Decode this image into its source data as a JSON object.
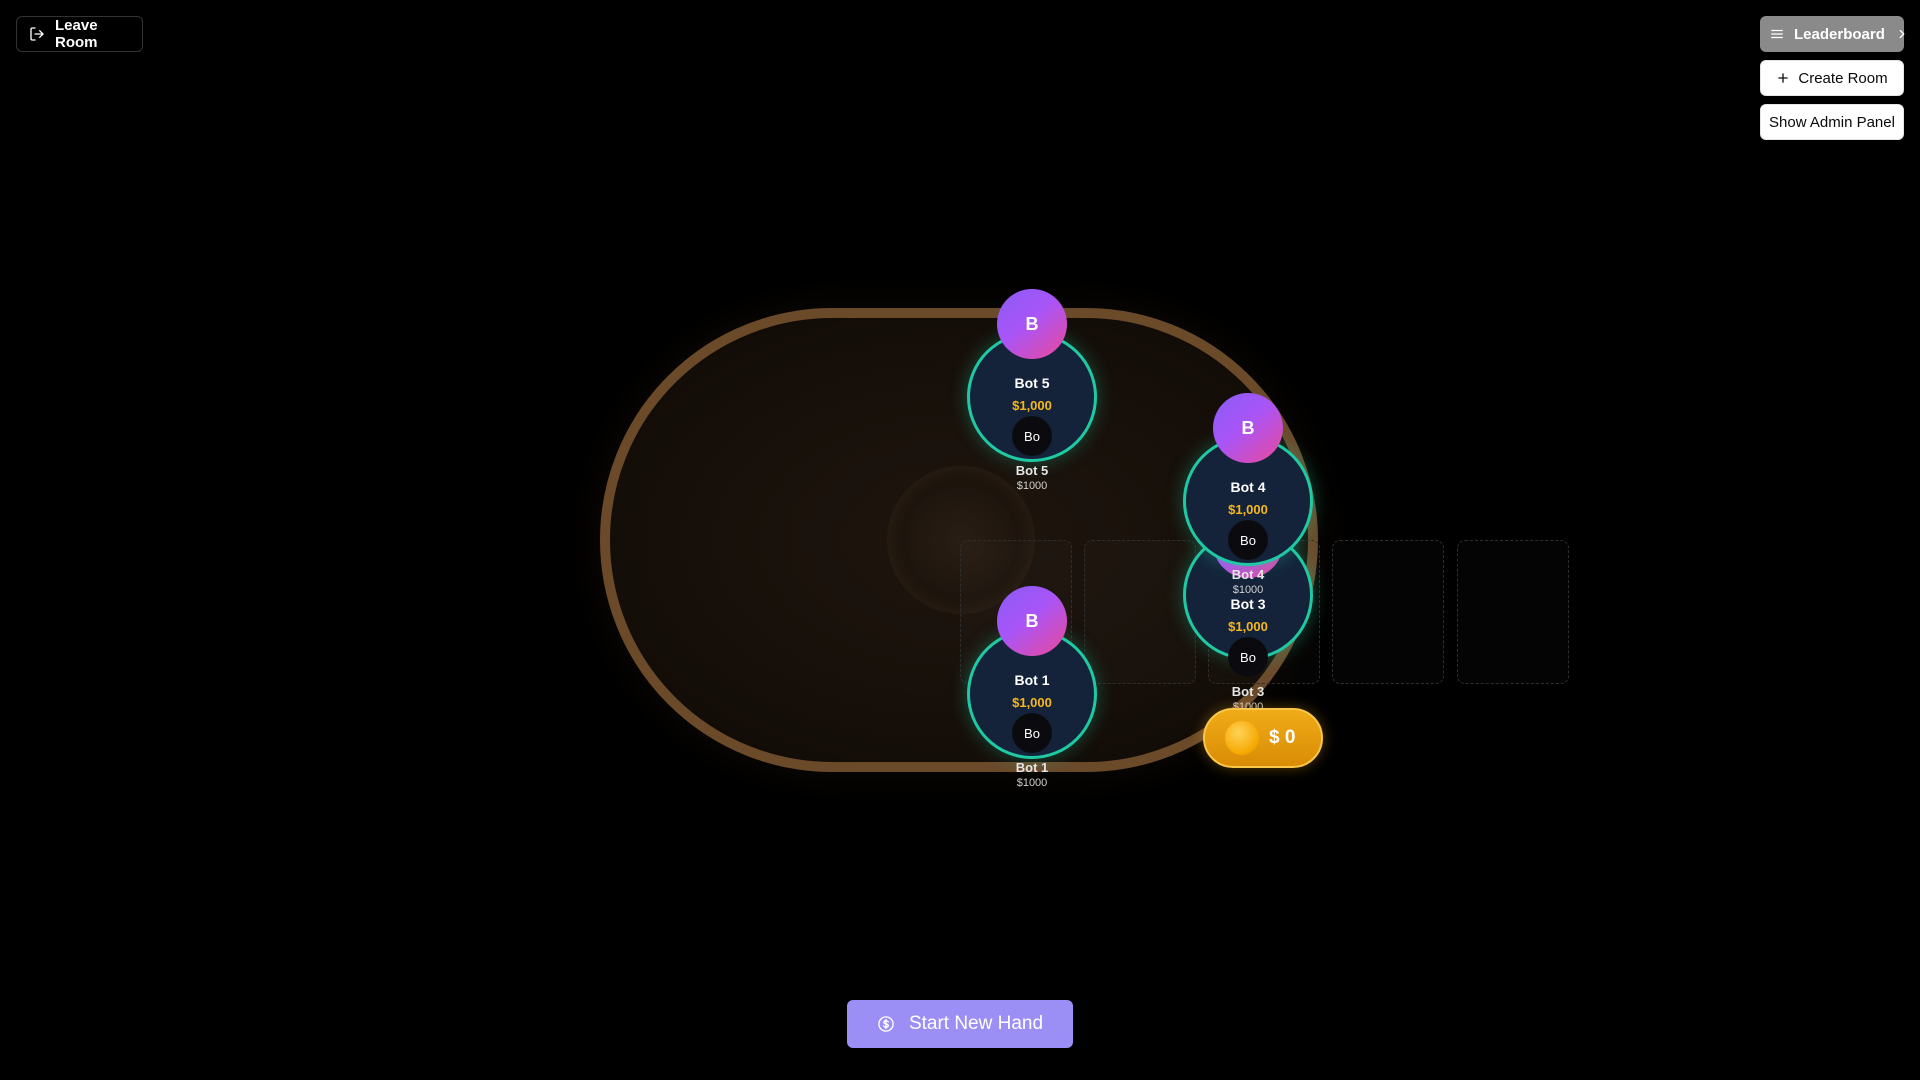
{
  "header": {
    "leave_room_label": "Leave Room",
    "leaderboard_label": "Leaderboard",
    "create_room_label": "Create Room",
    "admin_panel_label": "Show Admin Panel"
  },
  "seats": [
    {
      "avatar_letter": "B",
      "name": "Bot 5",
      "chips": "$1,000",
      "mini": "Bo",
      "label": "Bot 5",
      "amount": "$1000"
    },
    {
      "avatar_letter": "B",
      "name": "Bot 4",
      "chips": "$1,000",
      "mini": "Bo",
      "label": "Bot 4",
      "amount": "$1000"
    },
    {
      "avatar_letter": "B",
      "name": "Bot 3",
      "chips": "$1,000",
      "mini": "Bo",
      "label": "Bot 3",
      "amount": "$1000"
    },
    {
      "avatar_letter": "B",
      "name": "Bot 1",
      "chips": "$1,000",
      "mini": "Bo",
      "label": "Bot 1",
      "amount": "$1000"
    }
  ],
  "pot": {
    "currency": "$",
    "amount": "0",
    "display": "$ 0"
  },
  "actions": {
    "start_new_hand_label": "Start New Hand"
  },
  "colors": {
    "table_rail": "#6b4a2a",
    "seat_border": "#1fc9a3",
    "avatar_gradient": [
      "#8b5cf6",
      "#ec4899"
    ],
    "chips_text": "#f5b81c",
    "start_button": "#9b8ef5",
    "pot": "#f0ac18"
  },
  "icons": {
    "leave_room": "logout-icon",
    "leaderboard": "menu-icon",
    "leaderboard_arrow": "chevron-right-icon",
    "create_room": "plus-icon",
    "start_new_hand": "dollar-circle-icon",
    "pot": "coin-icon"
  }
}
